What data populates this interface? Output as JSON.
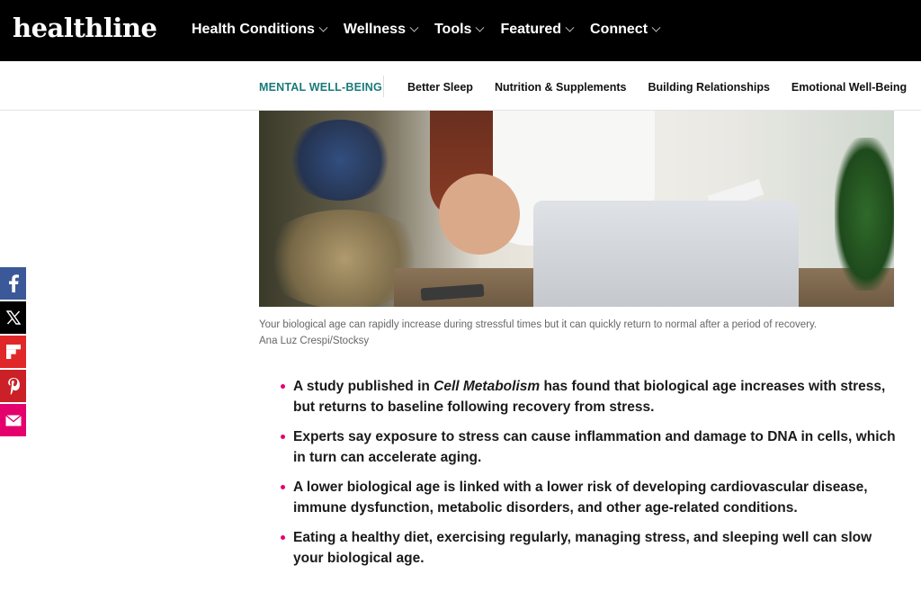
{
  "header": {
    "logo": "healthline",
    "nav": [
      {
        "label": "Health Conditions"
      },
      {
        "label": "Wellness"
      },
      {
        "label": "Tools"
      },
      {
        "label": "Featured"
      },
      {
        "label": "Connect"
      }
    ]
  },
  "subnav": {
    "category": "MENTAL WELL-BEING",
    "links": [
      {
        "label": "Better Sleep"
      },
      {
        "label": "Nutrition & Supplements"
      },
      {
        "label": "Building Relationships"
      },
      {
        "label": "Emotional Well-Being"
      }
    ]
  },
  "article": {
    "caption": "Your biological age can rapidly increase during stressful times but it can quickly return to normal after a period of recovery.",
    "credit": "Ana Luz Crespi/Stocksy",
    "bullets": {
      "b1_pre": "A study published in ",
      "b1_em": "Cell Metabolism",
      "b1_post": " has found that biological age increases with stress, but returns to baseline following recovery from stress.",
      "b2": "Experts say exposure to stress can cause inflammation and damage to DNA in cells, which in turn can accelerate aging.",
      "b3": "A lower biological age is linked with a lower risk of developing cardiovascular disease, immune dysfunction, metabolic disorders, and other age-related conditions.",
      "b4": "Eating a healthy diet, exercising regularly, managing stress, and sleeping well can slow your biological age."
    }
  },
  "social": [
    {
      "icon": "facebook-icon",
      "color": "#3b5998"
    },
    {
      "icon": "x-icon",
      "color": "#000000"
    },
    {
      "icon": "flipboard-icon",
      "color": "#e12828"
    },
    {
      "icon": "pinterest-icon",
      "color": "#cb2027"
    },
    {
      "icon": "email-icon",
      "color": "#e4006d"
    }
  ]
}
